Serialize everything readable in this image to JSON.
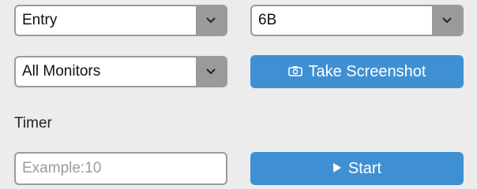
{
  "row1": {
    "left_select": {
      "value": "Entry"
    },
    "right_select": {
      "value": "6B"
    }
  },
  "row2": {
    "monitor_select": {
      "value": "All Monitors"
    },
    "screenshot_button": {
      "label": "Take Screenshot",
      "icon": "camera-icon"
    }
  },
  "timer": {
    "label": "Timer",
    "input": {
      "placeholder": "Example:10"
    },
    "start_button": {
      "label": "Start",
      "icon": "play-icon"
    }
  },
  "colors": {
    "background": "#ececec",
    "select_border": "#9a9a9a",
    "button_blue": "#3f90d3",
    "placeholder": "#9b9b9b"
  }
}
